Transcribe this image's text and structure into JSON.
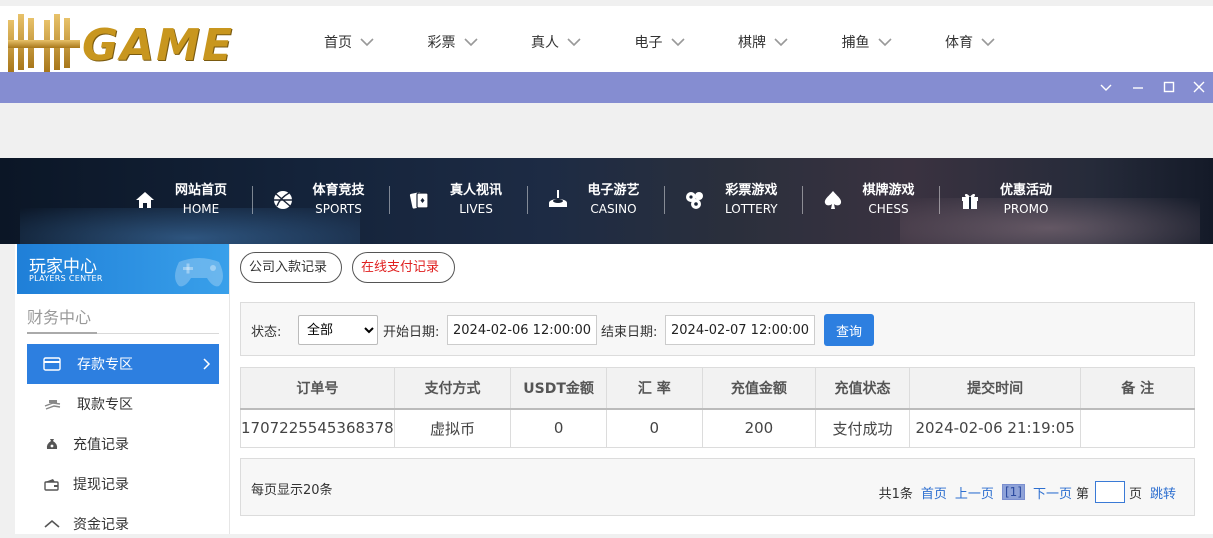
{
  "brand": {
    "logo_text": "GAME",
    "logo_mark": "HH"
  },
  "top_nav": [
    {
      "label": "首页"
    },
    {
      "label": "彩票"
    },
    {
      "label": "真人"
    },
    {
      "label": "电子"
    },
    {
      "label": "棋牌"
    },
    {
      "label": "捕鱼"
    },
    {
      "label": "体育"
    }
  ],
  "window_controls": [
    "chevron-down-icon",
    "minimize-icon",
    "maximize-icon",
    "close-icon"
  ],
  "game_nav": [
    {
      "cn": "网站首页",
      "en": "HOME",
      "icon": "home-icon"
    },
    {
      "cn": "体育竞技",
      "en": "SPORTS",
      "icon": "basketball-icon"
    },
    {
      "cn": "真人视讯",
      "en": "LIVES",
      "icon": "cards-icon"
    },
    {
      "cn": "电子游艺",
      "en": "CASINO",
      "icon": "slot-icon"
    },
    {
      "cn": "彩票游戏",
      "en": "LOTTERY",
      "icon": "lottery-balls-icon"
    },
    {
      "cn": "棋牌游戏",
      "en": "CHESS",
      "icon": "spade-icon"
    },
    {
      "cn": "优惠活动",
      "en": "PROMO",
      "icon": "gift-icon"
    }
  ],
  "sidebar": {
    "header_cn": "玩家中心",
    "header_en": "PLAYERS CENTER",
    "section_title": "财务中心",
    "items": [
      {
        "label": "存款专区",
        "active": true,
        "icon": "card-icon"
      },
      {
        "label": "取款专区",
        "active": false,
        "icon": "cash-icon"
      },
      {
        "label": "充值记录",
        "active": false,
        "icon": "money-bag-icon"
      },
      {
        "label": "提现记录",
        "active": false,
        "icon": "wallet-icon"
      },
      {
        "label": "资金记录",
        "active": false,
        "icon": "ledger-icon"
      }
    ]
  },
  "tabs": {
    "company": "公司入款记录",
    "online": "在线支付记录"
  },
  "filter": {
    "status_label": "状态:",
    "status_value": "全部",
    "start_label": "开始日期:",
    "start_value": "2024-02-06 12:00:00",
    "end_label": "结束日期:",
    "end_value": "2024-02-07 12:00:00",
    "query_label": "查询"
  },
  "table": {
    "headers": [
      "订单号",
      "支付方式",
      "USDT金额",
      "汇 率",
      "充值金额",
      "充值状态",
      "提交时间",
      "备 注"
    ],
    "rows": [
      [
        "1707225545368378",
        "虚拟币",
        "0",
        "0",
        "200",
        "支付成功",
        "2024-02-06 21:19:05",
        ""
      ]
    ]
  },
  "pager": {
    "per_page": "每页显示20条",
    "total": "共1条",
    "first": "首页",
    "prev": "上一页",
    "current": "[1]",
    "next": "下一页",
    "page_prefix": "第",
    "page_suffix": "页",
    "jump": "跳转"
  }
}
